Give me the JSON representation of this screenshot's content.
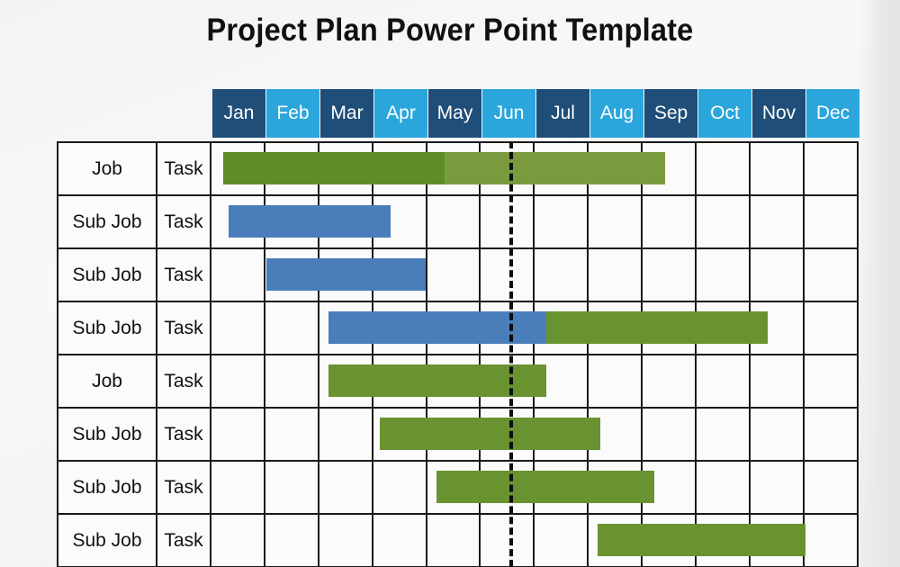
{
  "title": "Project Plan Power Point Template",
  "colors": {
    "header_dark_blue": "#1f4e79",
    "header_light_blue": "#2ba6dd",
    "bar_blue": "#4a7ebb",
    "bar_green_dark": "#5f8c28",
    "bar_green_light": "#7a9b3d",
    "bar_green": "#699330",
    "grid_line": "#1a1a1a",
    "today_line": "#0d0d0d",
    "background": "#f2f3f5"
  },
  "timeline": {
    "months": [
      {
        "label": "Jan",
        "shade": "dark"
      },
      {
        "label": "Feb",
        "shade": "light"
      },
      {
        "label": "Mar",
        "shade": "dark"
      },
      {
        "label": "Apr",
        "shade": "light"
      },
      {
        "label": "May",
        "shade": "dark"
      },
      {
        "label": "Jun",
        "shade": "light"
      },
      {
        "label": "Jul",
        "shade": "dark"
      },
      {
        "label": "Aug",
        "shade": "light"
      },
      {
        "label": "Sep",
        "shade": "dark"
      },
      {
        "label": "Oct",
        "shade": "light"
      },
      {
        "label": "Nov",
        "shade": "dark"
      },
      {
        "label": "Dec",
        "shade": "light"
      }
    ],
    "today_marker_month": "Jun"
  },
  "chart_data": {
    "type": "bar",
    "chart_kind": "gantt",
    "title": "Project Plan Power Point Template",
    "xlabel": "",
    "ylabel": "",
    "categories": [
      "Jan",
      "Feb",
      "Mar",
      "Apr",
      "May",
      "Jun",
      "Jul",
      "Aug",
      "Sep",
      "Oct",
      "Nov",
      "Dec"
    ],
    "today_marker_x": 5.5,
    "grid": true,
    "legend": "none",
    "rows": [
      {
        "job": "Job",
        "task": "Task",
        "segments": [
          {
            "color": "green-dark",
            "start": 1.2,
            "end": 5.3
          },
          {
            "color": "green-light",
            "start": 5.3,
            "end": 9.4
          }
        ]
      },
      {
        "job": "Sub Job",
        "task": "Task",
        "segments": [
          {
            "color": "blue",
            "start": 1.3,
            "end": 4.3
          }
        ]
      },
      {
        "job": "Sub Job",
        "task": "Task",
        "segments": [
          {
            "color": "blue",
            "start": 2.0,
            "end": 4.95
          }
        ]
      },
      {
        "job": "Sub Job",
        "task": "Task",
        "segments": [
          {
            "color": "blue",
            "start": 3.15,
            "end": 7.2
          },
          {
            "color": "green",
            "start": 7.2,
            "end": 11.3
          }
        ]
      },
      {
        "job": "Job",
        "task": "Task",
        "segments": [
          {
            "color": "green",
            "start": 3.15,
            "end": 7.2
          }
        ]
      },
      {
        "job": "Sub Job",
        "task": "Task",
        "segments": [
          {
            "color": "green",
            "start": 4.1,
            "end": 8.2
          }
        ]
      },
      {
        "job": "Sub Job",
        "task": "Task",
        "segments": [
          {
            "color": "green",
            "start": 5.15,
            "end": 9.2
          }
        ]
      },
      {
        "job": "Sub Job",
        "task": "Task",
        "segments": [
          {
            "color": "green",
            "start": 8.15,
            "end": 12.0
          }
        ]
      }
    ]
  }
}
